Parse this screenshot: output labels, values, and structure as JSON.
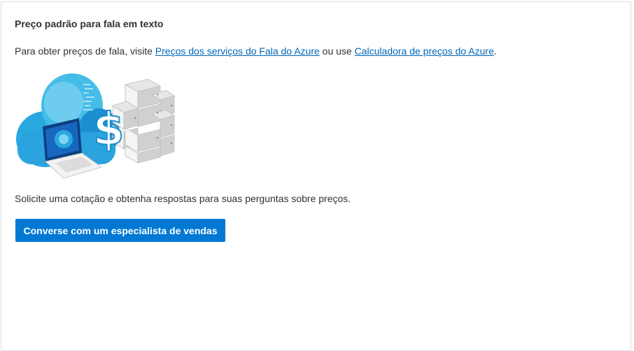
{
  "panel": {
    "title": "Preço padrão para fala em texto",
    "intro": {
      "prefix": "Para obter preços de fala, visite ",
      "link1": "Preços dos serviços do Fala do Azure",
      "middle": " ou use ",
      "link2": "Calculadora de preços do Azure",
      "suffix": "."
    },
    "illustration_icon": "cloud-laptop-servers-dollar-illustration",
    "quote_text": "Solicite uma cotação e obtenha respostas para suas perguntas sobre preços.",
    "cta_label": "Converse com um especialista de vendas"
  },
  "colors": {
    "link": "#0067b8",
    "button": "#0078d4",
    "text": "#323130"
  }
}
